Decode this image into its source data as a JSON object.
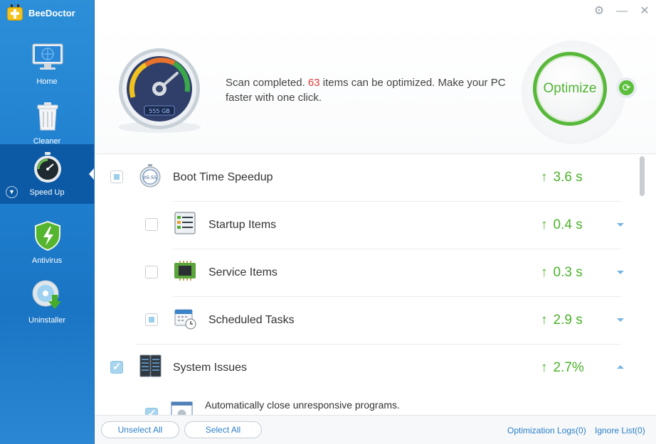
{
  "app": {
    "name": "BeeDoctor"
  },
  "sidebar": {
    "items": [
      {
        "label": "Home",
        "icon": "monitor-icon"
      },
      {
        "label": "Cleaner",
        "icon": "trash-icon"
      },
      {
        "label": "Speed Up",
        "icon": "stopwatch-icon",
        "active": true
      },
      {
        "label": "Antivirus",
        "icon": "shield-lightning-icon"
      },
      {
        "label": "Uninstaller",
        "icon": "disc-download-icon"
      }
    ]
  },
  "window": {
    "settings_icon": "gear-icon",
    "minimize_icon": "minimize-icon",
    "close_icon": "close-icon"
  },
  "header": {
    "gauge_label": "555 GB",
    "scan_prefix": "Scan completed.",
    "scan_count": "63",
    "scan_suffix": "items can be optimized. Make your PC faster with one click.",
    "optimize_label": "Optimize",
    "refresh_icon": "refresh-icon"
  },
  "list": {
    "rows": [
      {
        "label": "Boot Time Speedup",
        "value": "3.6 s",
        "icon": "stopwatch-boot-icon",
        "check": "partial",
        "indent": 0,
        "caret": ""
      },
      {
        "label": "Startup Items",
        "value": "0.4 s",
        "icon": "checklist-icon",
        "check": "empty",
        "indent": 1,
        "caret": "down"
      },
      {
        "label": "Service Items",
        "value": "0.3 s",
        "icon": "chip-icon",
        "check": "empty",
        "indent": 1,
        "caret": "down"
      },
      {
        "label": "Scheduled Tasks",
        "value": "2.9 s",
        "icon": "calendar-clock-icon",
        "check": "partial",
        "indent": 1,
        "caret": "down"
      },
      {
        "label": "System Issues",
        "value": "2.7%",
        "icon": "server-icon",
        "check": "checked",
        "indent": 0,
        "caret": "up"
      }
    ],
    "sub_item": {
      "label": "Automatically close unresponsive programs.",
      "icon": "window-gear-icon",
      "check": "checked"
    }
  },
  "footer": {
    "unselect_all": "Unselect All",
    "select_all": "Select All",
    "optimization_logs": "Optimization Logs(0)",
    "ignore_list": "Ignore List(0)"
  },
  "colors": {
    "sidebar": "#1f7fcf",
    "accent_green": "#4bb22b",
    "count_red": "#e23b3b",
    "link_blue": "#2c7fc6"
  }
}
